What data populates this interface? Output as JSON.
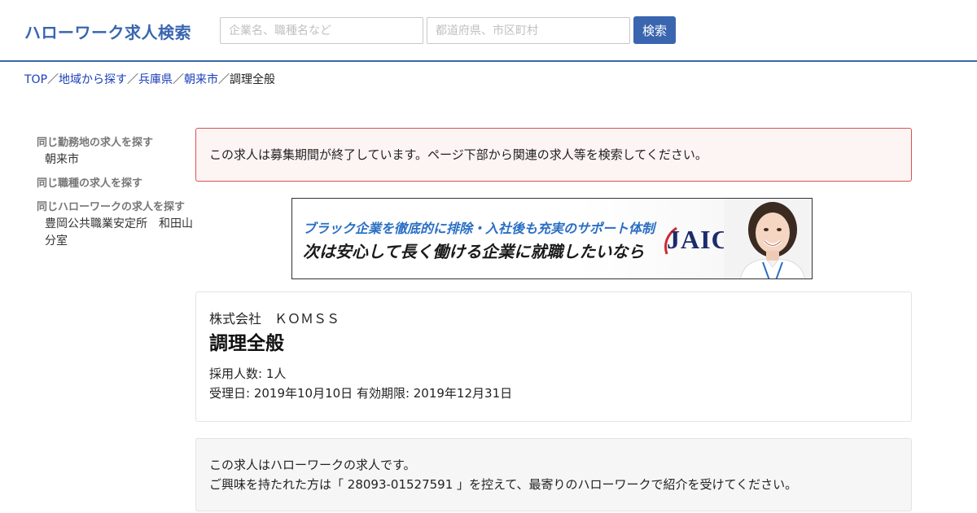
{
  "header": {
    "logo": "ハローワーク求人検索",
    "keyword_placeholder": "企業名、職種名など",
    "area_placeholder": "都道府県、市区町村",
    "search_button": "検索"
  },
  "breadcrumb": {
    "items": [
      "TOP",
      "地域から探す",
      "兵庫県",
      "朝来市"
    ],
    "current": "調理全般",
    "separator": "／"
  },
  "sidebar": {
    "same_location_heading": "同じ勤務地の求人を探す",
    "same_location_link": "朝来市",
    "same_job_heading": "同じ職種の求人を探す",
    "same_office_heading": "同じハローワークの求人を探す",
    "same_office_link": "豊岡公共職業安定所　和田山分室"
  },
  "alert": {
    "message": "この求人は募集期間が終了しています。ページ下部から関連の求人等を検索してください。"
  },
  "banner": {
    "line1": "ブラック企業を徹底的に排除・入社後も充実のサポート体制",
    "line2": "次は安心して長く働ける企業に就職したいなら",
    "logo": "JAIC"
  },
  "job": {
    "company": "株式会社　ＫＯＭＳＳ",
    "title": "調理全般",
    "headcount": "採用人数: 1人",
    "dates": "受理日: 2019年10月10日 有効期限: 2019年12月31日"
  },
  "info": {
    "line1": "この求人はハローワークの求人です。",
    "line2": "ご興味を持たれた方は「 28093-01527591 」を控えて、最寄りのハローワークで紹介を受けてください。"
  },
  "colors": {
    "brand": "#3a66b0",
    "link": "#1a3fb8",
    "alert_border": "#d9534f",
    "alert_bg": "#fdf4f4"
  }
}
